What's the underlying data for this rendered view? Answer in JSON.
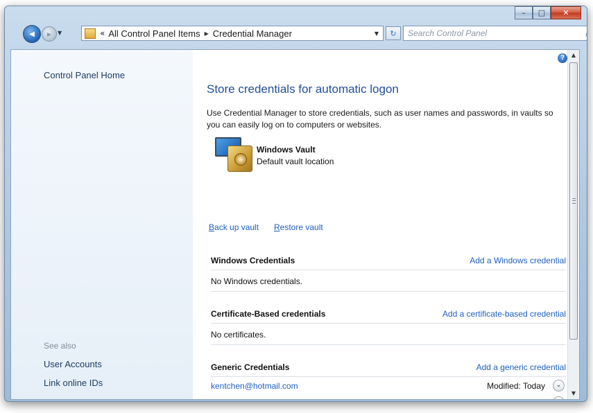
{
  "window": {
    "minimize_glyph": "–",
    "maximize_glyph": "□",
    "close_glyph": "✕"
  },
  "navigation": {
    "back_glyph": "◀",
    "forward_glyph": "▶",
    "recent_glyph": "▼",
    "breadcrumb_chevron": "«",
    "breadcrumbs": [
      "All Control Panel Items",
      "Credential Manager"
    ],
    "breadcrumb_separator": "▶",
    "address_dropdown_glyph": "▼",
    "refresh_glyph": "↻",
    "search_placeholder": "Search Control Panel",
    "search_glyph": "⌕"
  },
  "sidebar": {
    "home_link": "Control Panel Home",
    "see_also_label": "See also",
    "see_also_links": [
      "User Accounts",
      "Link online IDs"
    ]
  },
  "main": {
    "help_glyph": "?",
    "title": "Store credentials for automatic logon",
    "description": "Use Credential Manager to store credentials, such as user names and passwords, in vaults so you can easily log on to computers or websites.",
    "vault": {
      "name": "Windows Vault",
      "subtitle": "Default vault location"
    },
    "actions": {
      "backup_initial": "B",
      "backup_rest": "ack up vault",
      "restore_initial": "R",
      "restore_rest": "estore vault"
    },
    "sections": {
      "windows": {
        "title": "Windows Credentials",
        "add_link": "Add a Windows credential",
        "empty_text": "No Windows credentials."
      },
      "certificate": {
        "title": "Certificate-Based credentials",
        "add_link": "Add a certificate-based credential",
        "empty_text": "No certificates."
      },
      "generic": {
        "title": "Generic Credentials",
        "add_link": "Add a generic credential",
        "items": [
          {
            "name": "kentchen@hotmail.com",
            "modified": "Modified:  Today"
          }
        ]
      }
    },
    "expand_glyph": "⌄"
  },
  "scrollbar": {
    "up_glyph": "▲",
    "down_glyph": "▼"
  },
  "colors": {
    "link": "#1f5fbf",
    "title": "#1f4e99",
    "sidebar_link": "#1e3d64",
    "muted": "#848e99"
  }
}
